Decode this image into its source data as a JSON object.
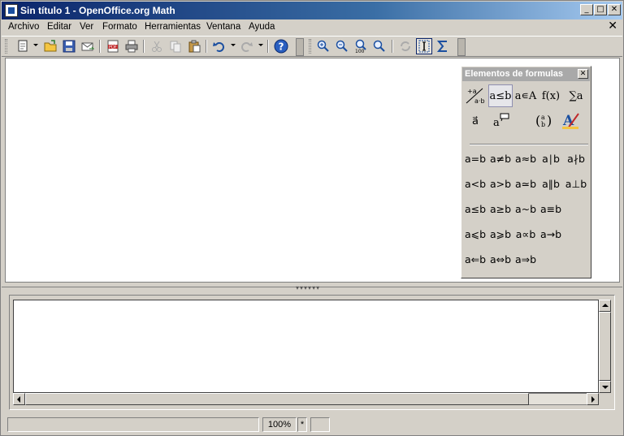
{
  "window": {
    "title": "Sin título 1 - OpenOffice.org Math"
  },
  "window_buttons": {
    "minimize": "_",
    "maximize": "□",
    "close": "✕"
  },
  "menu": {
    "items": [
      "Archivo",
      "Editar",
      "Ver",
      "Formato",
      "Herramientas",
      "Ventana",
      "Ayuda"
    ],
    "doc_close": "✕"
  },
  "toolbar": {
    "buttons": [
      "new-icon",
      "open-folder-icon",
      "save-icon",
      "email-icon",
      "export-pdf-icon",
      "print-icon",
      "cut-icon",
      "copy-icon",
      "paste-icon",
      "undo-icon",
      "redo-icon",
      "help-icon",
      "zoom-in-icon",
      "zoom-out-icon",
      "zoom-100-icon",
      "zoom-icon",
      "update-icon",
      "formula-cursor-icon",
      "symbols-icon"
    ],
    "zoom_100_label": "100"
  },
  "elements_panel": {
    "title": "Elementos de formulas",
    "close": "✕",
    "categories": [
      {
        "name": "unary-binary-operators",
        "label": "+a a·b"
      },
      {
        "name": "relations",
        "label": "a≤b"
      },
      {
        "name": "set-operations",
        "label": "a∊A"
      },
      {
        "name": "functions",
        "label": "f(x)"
      },
      {
        "name": "operators",
        "label": "∑a"
      },
      {
        "name": "attributes",
        "label": "a⃗"
      },
      {
        "name": "others",
        "label": "a"
      },
      {
        "name": "brackets",
        "label": "(a b)"
      },
      {
        "name": "formats",
        "label": "A"
      }
    ],
    "selected_category": "relations",
    "symbols": [
      [
        "a=b",
        "a≠b",
        "a≈b",
        "a∣b",
        "a∤b"
      ],
      [
        "a<b",
        "a>b",
        "a≃b",
        "a∥b",
        "a⊥b"
      ],
      [
        "a≤b",
        "a≥b",
        "a~b",
        "a≡b",
        ""
      ],
      [
        "a⩽b",
        "a⩾b",
        "a∝b",
        "a→b",
        ""
      ],
      [
        "a⇐b",
        "a⇔b",
        "a⇒b",
        "",
        ""
      ]
    ]
  },
  "statusbar": {
    "zoom": "100%",
    "modified": "*"
  }
}
